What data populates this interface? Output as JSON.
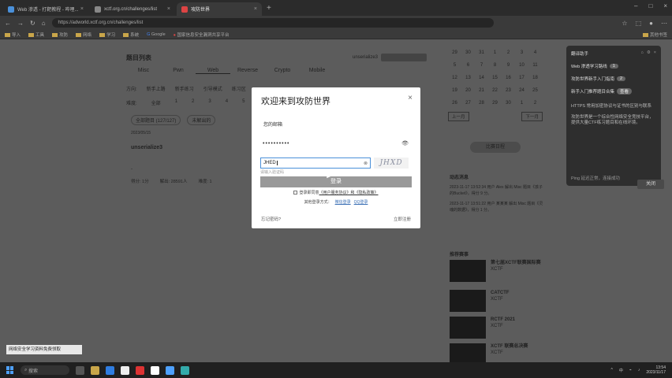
{
  "browser": {
    "tabs": [
      {
        "label": "Web 渗透 - 打靶教程 - 哔哩...",
        "active": false
      },
      {
        "label": "xctf.org.cn/challenges/list",
        "active": false
      },
      {
        "label": "攻防世界",
        "active": true
      }
    ],
    "url": "https://adworld.xctf.org.cn/challenges/list",
    "bookmarks": [
      "导入",
      "工具",
      "攻防",
      "网络",
      "学习",
      "系统",
      "Google",
      "国家信息安全漏洞共享平台"
    ],
    "bookmarks_right": "其他书签"
  },
  "page": {
    "title": "题目列表",
    "user_label": "unserialize3",
    "categories": [
      "Misc",
      "Pwn",
      "Web",
      "Reverse",
      "Crypto",
      "Mobile"
    ],
    "selected_category": "Web",
    "filters_row": [
      "方向:",
      "新手上路",
      "新手练习",
      "引导模式",
      "练习区",
      "..."
    ],
    "difficulty_row": [
      "难度:",
      "全部",
      "1",
      "2",
      "3",
      "4",
      "5",
      "6",
      "7",
      "8"
    ],
    "pills": [
      "全部题目 (127/127)",
      "未解出的"
    ],
    "challenge_meta": "2023/05/15",
    "challenge_name": "unserialize3",
    "dash": "-",
    "challenge_stats": [
      "得分: 1分",
      "解出: 28591人",
      "难度: 1"
    ]
  },
  "calendar": {
    "days": [
      "29",
      "30",
      "31",
      "1",
      "2",
      "3",
      "4",
      "5",
      "6",
      "7",
      "8",
      "9",
      "10",
      "11",
      "12",
      "13",
      "14",
      "15",
      "16",
      "17",
      "18",
      "19",
      "20",
      "21",
      "22",
      "23",
      "24",
      "25",
      "26",
      "27",
      "28",
      "29",
      "30",
      "1",
      "2"
    ],
    "prev": "上一月",
    "next": "下一月",
    "stat_button": "比赛日程"
  },
  "news": {
    "heading": "动态消息",
    "items": [
      "2023-11-17 13:52:34 用户 Alex 解出 Misc 题目《孩子的Bucket》，得分 9 分。",
      "2023-11-17 13:51:22 用户 某某某 解出 Misc 题目《灵魂的数据》，得分 1 分。"
    ]
  },
  "recommend": {
    "heading": "推荐赛事",
    "items": [
      {
        "title": "第七届XCTF联赛国际赛",
        "sub": "XCTF"
      },
      {
        "title": "CATCTF",
        "sub": "XCTF"
      },
      {
        "title": "RCTF 2021",
        "sub": "XCTF"
      },
      {
        "title": "XCTF 联赛总决赛",
        "sub": "XCTF"
      }
    ]
  },
  "left_banner": "网络安全学习资料免费领取",
  "right_panel": {
    "title": "翻译助手",
    "items": [
      {
        "text": "Web 渗透学习路线",
        "badge": "1"
      },
      {
        "text": "攻防世界新手入门指南",
        "badge": "2"
      }
    ],
    "line1": "新手入门推荐题目合集",
    "badge3": "查看",
    "line2": "HTTPS 常用加密协议与证书的区别与联系",
    "paragraph": "攻防世界是一个综合性网络安全竞技平台，提供大量CTF练习题目和在线环境。",
    "footer": "Ping 延迟正常，连接成功",
    "side_button": "关闭"
  },
  "modal": {
    "title": "欢迎来到攻防世界",
    "close": "×",
    "username_label": "您的邮箱",
    "password_mask": "••••••••••",
    "captcha_value": "JHED",
    "captcha_image_text": "JHXD",
    "captcha_hint": "请输入验证码",
    "login_button": "登录",
    "agree_prefix": "登录即同意",
    "agree_terms": "《用户服务协议》和《隐私政策》",
    "third_party_label": "其他登录方式：",
    "third_party_1": "微信登录",
    "third_party_2": "QQ登录",
    "forgot": "忘记密码?",
    "register": "立即注册"
  },
  "taskbar": {
    "search_label": "搜索",
    "time": "13:54",
    "date": "2023/11/17"
  }
}
